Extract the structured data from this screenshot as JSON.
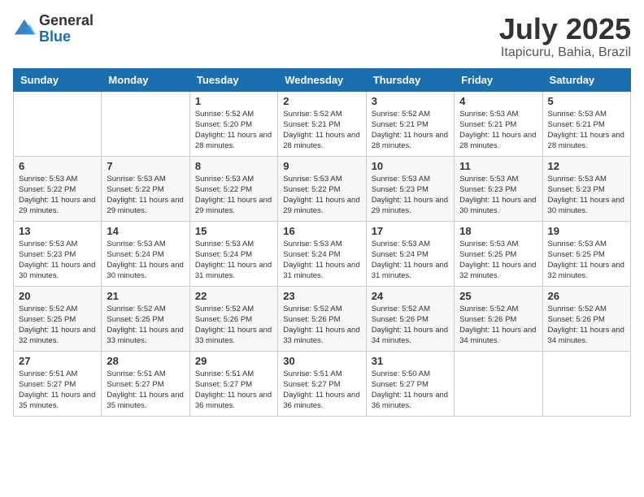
{
  "header": {
    "logo_general": "General",
    "logo_blue": "Blue",
    "month_year": "July 2025",
    "location": "Itapicuru, Bahia, Brazil"
  },
  "days_of_week": [
    "Sunday",
    "Monday",
    "Tuesday",
    "Wednesday",
    "Thursday",
    "Friday",
    "Saturday"
  ],
  "weeks": [
    [
      {
        "day": "",
        "info": ""
      },
      {
        "day": "",
        "info": ""
      },
      {
        "day": "1",
        "info": "Sunrise: 5:52 AM\nSunset: 5:20 PM\nDaylight: 11 hours and 28 minutes."
      },
      {
        "day": "2",
        "info": "Sunrise: 5:52 AM\nSunset: 5:21 PM\nDaylight: 11 hours and 28 minutes."
      },
      {
        "day": "3",
        "info": "Sunrise: 5:52 AM\nSunset: 5:21 PM\nDaylight: 11 hours and 28 minutes."
      },
      {
        "day": "4",
        "info": "Sunrise: 5:53 AM\nSunset: 5:21 PM\nDaylight: 11 hours and 28 minutes."
      },
      {
        "day": "5",
        "info": "Sunrise: 5:53 AM\nSunset: 5:21 PM\nDaylight: 11 hours and 28 minutes."
      }
    ],
    [
      {
        "day": "6",
        "info": "Sunrise: 5:53 AM\nSunset: 5:22 PM\nDaylight: 11 hours and 29 minutes."
      },
      {
        "day": "7",
        "info": "Sunrise: 5:53 AM\nSunset: 5:22 PM\nDaylight: 11 hours and 29 minutes."
      },
      {
        "day": "8",
        "info": "Sunrise: 5:53 AM\nSunset: 5:22 PM\nDaylight: 11 hours and 29 minutes."
      },
      {
        "day": "9",
        "info": "Sunrise: 5:53 AM\nSunset: 5:22 PM\nDaylight: 11 hours and 29 minutes."
      },
      {
        "day": "10",
        "info": "Sunrise: 5:53 AM\nSunset: 5:23 PM\nDaylight: 11 hours and 29 minutes."
      },
      {
        "day": "11",
        "info": "Sunrise: 5:53 AM\nSunset: 5:23 PM\nDaylight: 11 hours and 30 minutes."
      },
      {
        "day": "12",
        "info": "Sunrise: 5:53 AM\nSunset: 5:23 PM\nDaylight: 11 hours and 30 minutes."
      }
    ],
    [
      {
        "day": "13",
        "info": "Sunrise: 5:53 AM\nSunset: 5:23 PM\nDaylight: 11 hours and 30 minutes."
      },
      {
        "day": "14",
        "info": "Sunrise: 5:53 AM\nSunset: 5:24 PM\nDaylight: 11 hours and 30 minutes."
      },
      {
        "day": "15",
        "info": "Sunrise: 5:53 AM\nSunset: 5:24 PM\nDaylight: 11 hours and 31 minutes."
      },
      {
        "day": "16",
        "info": "Sunrise: 5:53 AM\nSunset: 5:24 PM\nDaylight: 11 hours and 31 minutes."
      },
      {
        "day": "17",
        "info": "Sunrise: 5:53 AM\nSunset: 5:24 PM\nDaylight: 11 hours and 31 minutes."
      },
      {
        "day": "18",
        "info": "Sunrise: 5:53 AM\nSunset: 5:25 PM\nDaylight: 11 hours and 32 minutes."
      },
      {
        "day": "19",
        "info": "Sunrise: 5:53 AM\nSunset: 5:25 PM\nDaylight: 11 hours and 32 minutes."
      }
    ],
    [
      {
        "day": "20",
        "info": "Sunrise: 5:52 AM\nSunset: 5:25 PM\nDaylight: 11 hours and 32 minutes."
      },
      {
        "day": "21",
        "info": "Sunrise: 5:52 AM\nSunset: 5:25 PM\nDaylight: 11 hours and 33 minutes."
      },
      {
        "day": "22",
        "info": "Sunrise: 5:52 AM\nSunset: 5:26 PM\nDaylight: 11 hours and 33 minutes."
      },
      {
        "day": "23",
        "info": "Sunrise: 5:52 AM\nSunset: 5:26 PM\nDaylight: 11 hours and 33 minutes."
      },
      {
        "day": "24",
        "info": "Sunrise: 5:52 AM\nSunset: 5:26 PM\nDaylight: 11 hours and 34 minutes."
      },
      {
        "day": "25",
        "info": "Sunrise: 5:52 AM\nSunset: 5:26 PM\nDaylight: 11 hours and 34 minutes."
      },
      {
        "day": "26",
        "info": "Sunrise: 5:52 AM\nSunset: 5:26 PM\nDaylight: 11 hours and 34 minutes."
      }
    ],
    [
      {
        "day": "27",
        "info": "Sunrise: 5:51 AM\nSunset: 5:27 PM\nDaylight: 11 hours and 35 minutes."
      },
      {
        "day": "28",
        "info": "Sunrise: 5:51 AM\nSunset: 5:27 PM\nDaylight: 11 hours and 35 minutes."
      },
      {
        "day": "29",
        "info": "Sunrise: 5:51 AM\nSunset: 5:27 PM\nDaylight: 11 hours and 36 minutes."
      },
      {
        "day": "30",
        "info": "Sunrise: 5:51 AM\nSunset: 5:27 PM\nDaylight: 11 hours and 36 minutes."
      },
      {
        "day": "31",
        "info": "Sunrise: 5:50 AM\nSunset: 5:27 PM\nDaylight: 11 hours and 36 minutes."
      },
      {
        "day": "",
        "info": ""
      },
      {
        "day": "",
        "info": ""
      }
    ]
  ]
}
